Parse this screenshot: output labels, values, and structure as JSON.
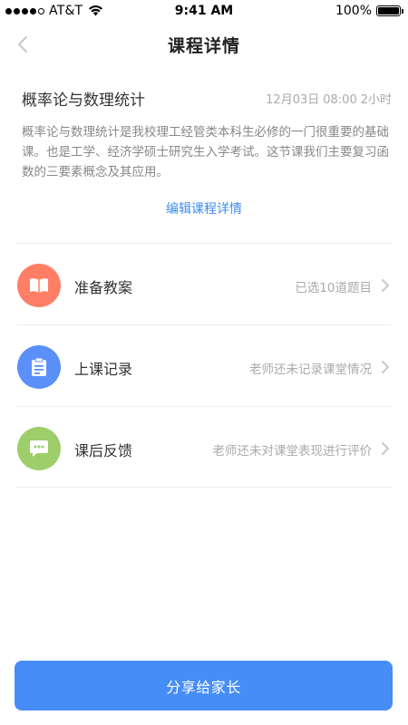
{
  "status_bar": {
    "carrier": "AT&T",
    "time": "9:41 AM",
    "battery": "100%"
  },
  "nav": {
    "title": "课程详情"
  },
  "course": {
    "name": "概率论与数理统计",
    "date": "12月03日",
    "time": "08:00",
    "duration": "2小时",
    "description": "概率论与数理统计是我校理工经管类本科生必修的一门很重要的基础课。也是工学、经济学硕士研究生入学考试。这节课我们主要复习函数的三要素概念及其应用。",
    "edit_label": "编辑课程详情"
  },
  "rows": [
    {
      "label": "准备教案",
      "status": "已选10道题目",
      "icon": "book-icon",
      "color": "#ff7f66"
    },
    {
      "label": "上课记录",
      "status": "老师还未记录课堂情况",
      "icon": "clipboard-icon",
      "color": "#5b8ff9"
    },
    {
      "label": "课后反馈",
      "status": "老师还未对课堂表现进行评价",
      "icon": "chat-bubble-icon",
      "color": "#9dce6a"
    }
  ],
  "share_label": "分享给家长",
  "colors": {
    "accent": "#468df8",
    "link": "#3c8cf0"
  }
}
